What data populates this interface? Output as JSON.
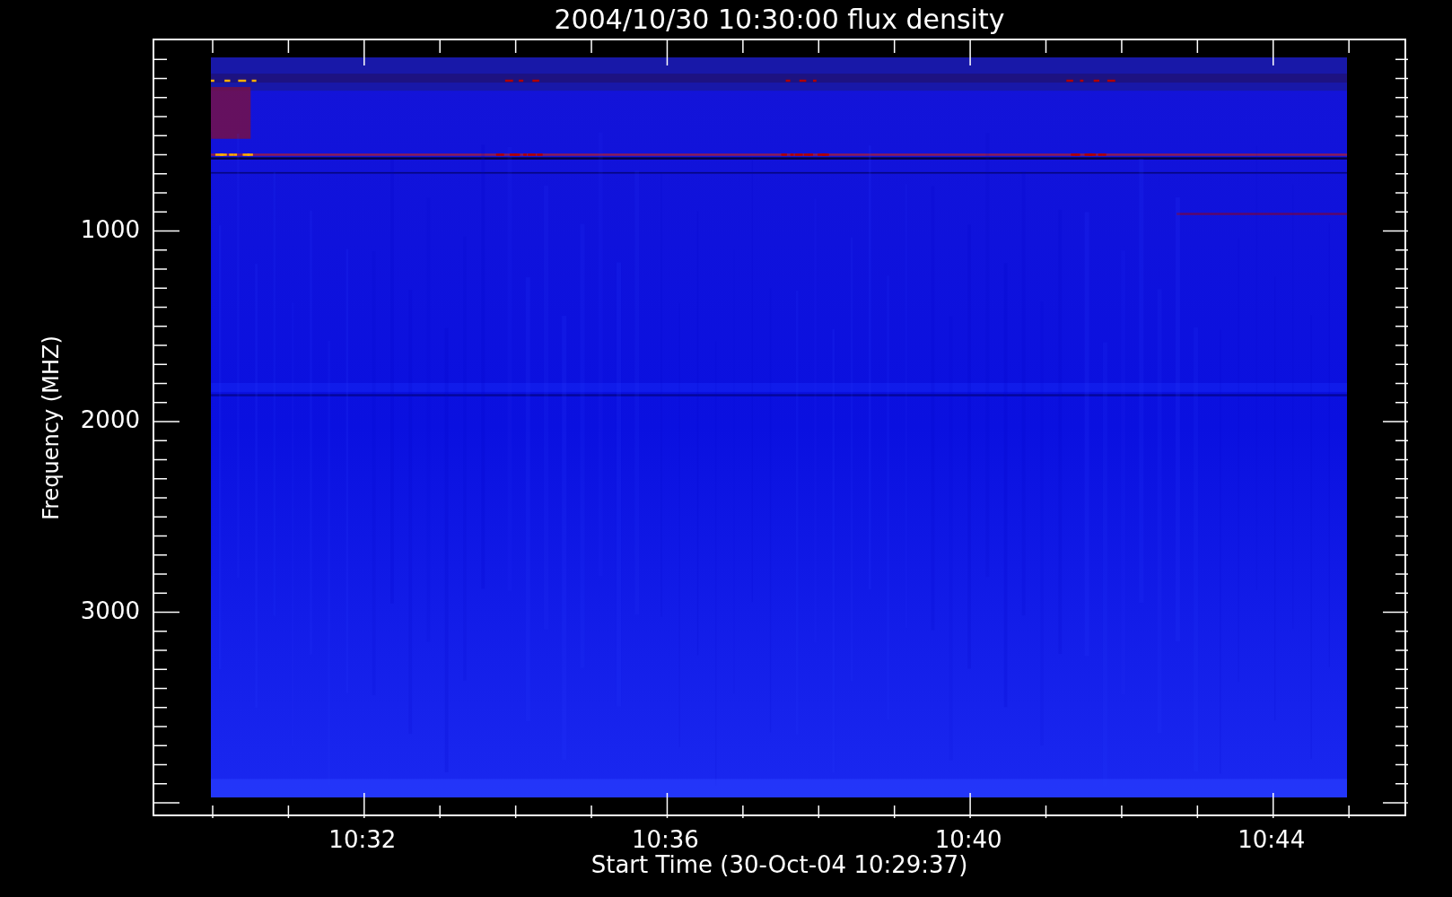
{
  "title": "2004/10/30 10:30:00 flux density",
  "y_axis": {
    "title": "Frequency (MHZ)",
    "tick_labels": [
      "1000",
      "2000",
      "3000"
    ]
  },
  "x_axis": {
    "title": "Start Time (30-Oct-04 10:29:37)",
    "tick_labels": [
      "10:32",
      "10:36",
      "10:40",
      "10:44"
    ]
  }
}
